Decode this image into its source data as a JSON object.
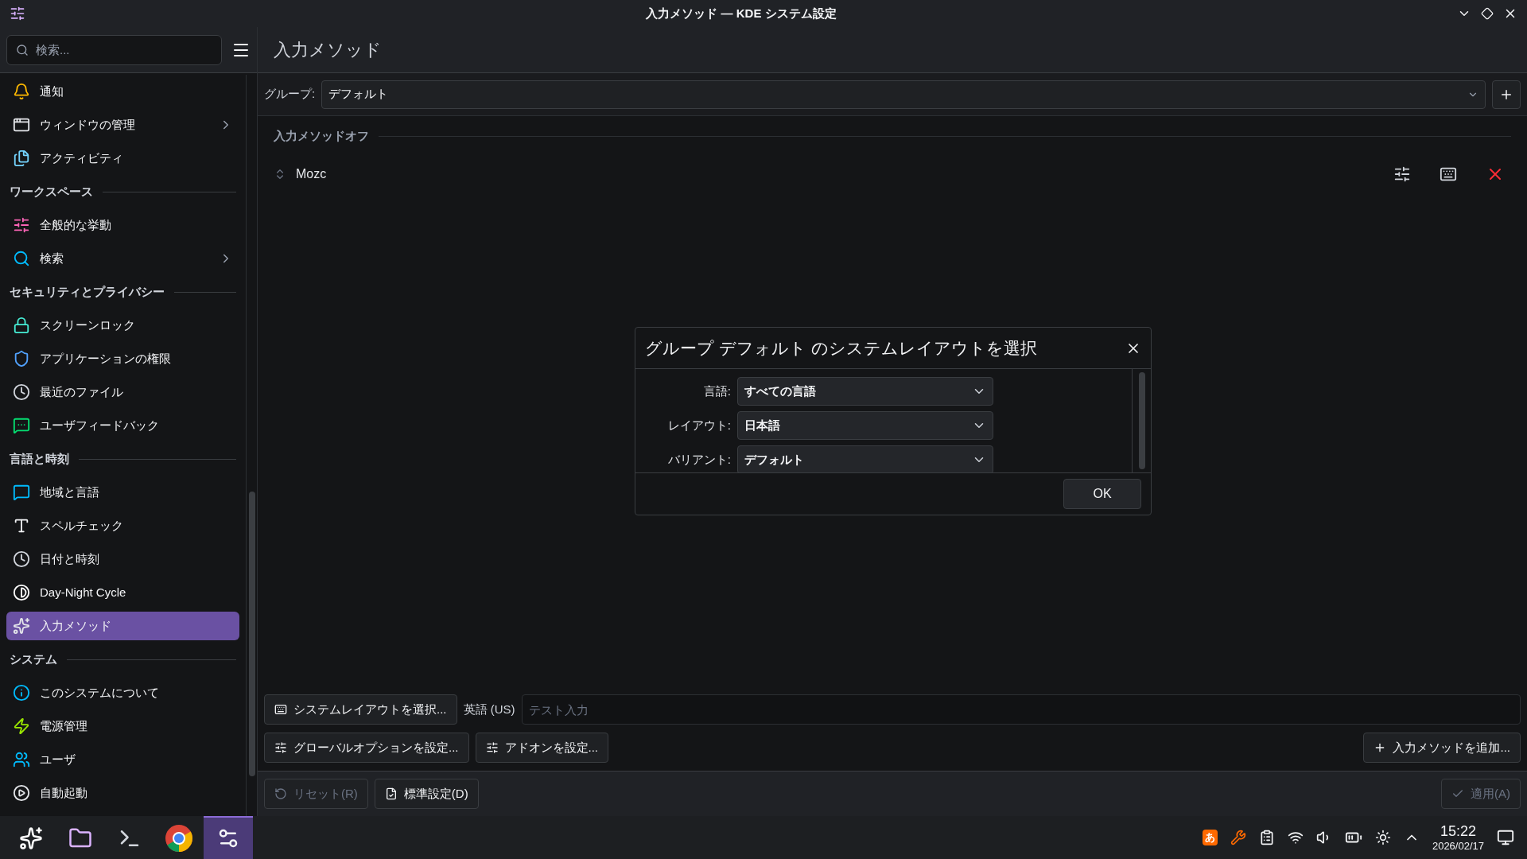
{
  "window": {
    "title": "入力メソッド — KDE システム設定"
  },
  "sidebar": {
    "search": {
      "placeholder": "検索..."
    },
    "items": [
      {
        "kind": "item",
        "label": "通知",
        "selected": false,
        "submenu": false
      },
      {
        "kind": "item",
        "label": "ウィンドウの管理",
        "selected": false,
        "submenu": true
      },
      {
        "kind": "item",
        "label": "アクティビティ",
        "selected": false,
        "submenu": false
      },
      {
        "kind": "header",
        "label": "ワークスペース"
      },
      {
        "kind": "item",
        "label": "全般的な挙動",
        "selected": false,
        "submenu": false
      },
      {
        "kind": "item",
        "label": "検索",
        "selected": false,
        "submenu": true
      },
      {
        "kind": "header",
        "label": "セキュリティとプライバシー"
      },
      {
        "kind": "item",
        "label": "スクリーンロック",
        "selected": false,
        "submenu": false
      },
      {
        "kind": "item",
        "label": "アプリケーションの権限",
        "selected": false,
        "submenu": false
      },
      {
        "kind": "item",
        "label": "最近のファイル",
        "selected": false,
        "submenu": false
      },
      {
        "kind": "item",
        "label": "ユーザフィードバック",
        "selected": false,
        "submenu": false
      },
      {
        "kind": "header",
        "label": "言語と時刻"
      },
      {
        "kind": "item",
        "label": "地域と言語",
        "selected": false,
        "submenu": false
      },
      {
        "kind": "item",
        "label": "スペルチェック",
        "selected": false,
        "submenu": false
      },
      {
        "kind": "item",
        "label": "日付と時刻",
        "selected": false,
        "submenu": false
      },
      {
        "kind": "item",
        "label": "Day-Night Cycle",
        "selected": false,
        "submenu": false
      },
      {
        "kind": "item",
        "label": "入力メソッド",
        "selected": true,
        "submenu": false
      },
      {
        "kind": "header",
        "label": "システム"
      },
      {
        "kind": "item",
        "label": "このシステムについて",
        "selected": false,
        "submenu": false
      },
      {
        "kind": "item",
        "label": "電源管理",
        "selected": false,
        "submenu": false
      },
      {
        "kind": "item",
        "label": "ユーザ",
        "selected": false,
        "submenu": false
      },
      {
        "kind": "item",
        "label": "自動起動",
        "selected": false,
        "submenu": false
      }
    ]
  },
  "page": {
    "title": "入力メソッド",
    "group_label": "グループ:",
    "group_value": "デフォルト",
    "section": "入力メソッドオフ",
    "methods": [
      {
        "name": "Mozc"
      }
    ],
    "layout_button": "システムレイアウトを選択...",
    "layout_name": "英語 (US)",
    "test_input": {
      "placeholder": "テスト入力"
    },
    "global_button": "グローバルオプションを設定...",
    "addon_button": "アドオンを設定...",
    "add_button": "入力メソッドを追加...",
    "reset_button": {
      "label": "リセット(R)",
      "disabled": true
    },
    "default_button": {
      "label": "標準設定(D)",
      "disabled": false
    },
    "apply_button": {
      "label": "適用(A)",
      "disabled": true
    }
  },
  "dialog": {
    "title": "グループ デフォルト のシステムレイアウトを選択",
    "fields": [
      {
        "label": "言語:",
        "value": "すべての言語"
      },
      {
        "label": "レイアウト:",
        "value": "日本語"
      },
      {
        "label": "バリアント:",
        "value": "デフォルト"
      }
    ],
    "ok": "OK"
  },
  "taskbar": {
    "apps": [
      {
        "kind": "launcher",
        "selected": false
      },
      {
        "kind": "files",
        "selected": false
      },
      {
        "kind": "terminal",
        "selected": false
      },
      {
        "kind": "browser",
        "selected": false
      },
      {
        "kind": "settings",
        "selected": true
      }
    ],
    "ime": "あ",
    "time": "15:22",
    "date": "2026/02/17"
  }
}
